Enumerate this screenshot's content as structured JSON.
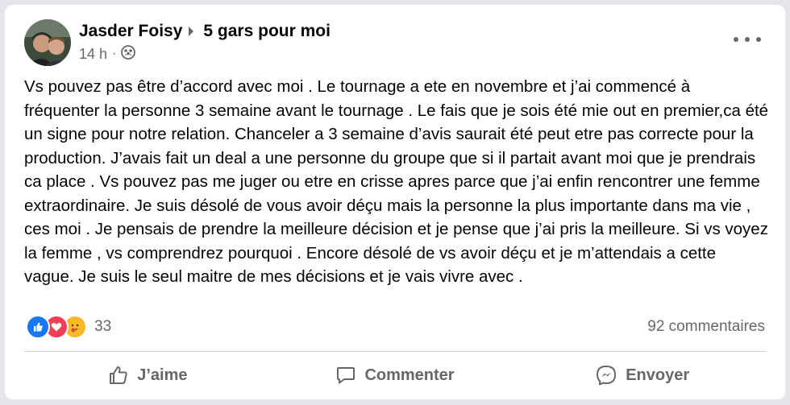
{
  "post": {
    "author": "Jasder Foisy",
    "group": "5 gars pour moi",
    "time": "14 h",
    "audience_icon": "group-audience-icon",
    "text": "Vs pouvez pas être d’accord avec moi . Le tournage a ete en novembre et j’ai commencé à fréquenter la personne 3 semaine avant le tournage . Le fais que je sois été mie out en premier,ca été un signe pour notre relation. Chanceler a 3 semaine d’avis saurait été peut etre pas correcte pour la production. J’avais fait un deal a une personne du groupe que si il partait avant moi que je prendrais ca place . Vs pouvez pas me juger ou etre en crisse apres parce que j’ai enfin rencontrer une femme extraordinaire. Je suis désolé de vous avoir déçu mais la personne la plus importante dans ma vie , ces moi . Je pensais de prendre la meilleure décision et je pense que j’ai pris la meilleure. Si vs voyez la femme , vs comprendrez pourquoi . Encore désolé de vs avoir déçu et je m’attendais a cette vague. Je suis le seul maitre de mes décisions et je vais vivre avec ."
  },
  "reactions": {
    "count": "33",
    "icons": [
      "like-reaction-icon",
      "love-reaction-icon",
      "care-reaction-icon"
    ]
  },
  "comments": {
    "count_label": "92 commentaires"
  },
  "actions": {
    "like": "J’aime",
    "comment": "Commenter",
    "send": "Envoyer"
  },
  "colors": {
    "text": "#050505",
    "secondary": "#65676b",
    "like_blue": "#1877f2",
    "love_red": "#f33e58",
    "care_yellow": "#f7b928",
    "card_bg": "#ffffff",
    "page_bg": "#e4e6ea"
  }
}
